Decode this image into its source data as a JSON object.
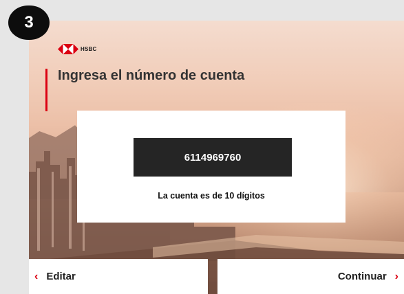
{
  "step": {
    "number": "3"
  },
  "brand": {
    "name": "HSBC",
    "color": "#db0011",
    "icon": "hsbc-hexagon-logo-icon"
  },
  "page": {
    "title": "Ingresa el número de cuenta"
  },
  "account": {
    "number": "6114969760",
    "note": "La cuenta es de 10 dígitos"
  },
  "actions": {
    "edit_label": "Editar",
    "edit_icon": "chevron-left-icon",
    "continue_label": "Continuar",
    "continue_icon": "chevron-right-icon"
  }
}
